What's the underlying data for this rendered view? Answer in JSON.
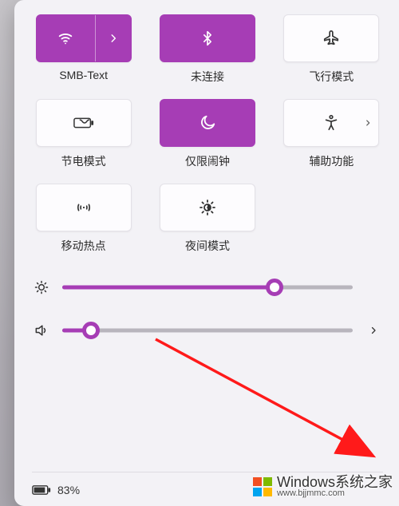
{
  "tiles": [
    {
      "id": "wifi",
      "label": "SMB-Text",
      "icon": "wifi-icon",
      "active": true,
      "split": true
    },
    {
      "id": "bluetooth",
      "label": "未连接",
      "icon": "bluetooth-icon",
      "active": true,
      "split": false
    },
    {
      "id": "airplane",
      "label": "飞行模式",
      "icon": "airplane-icon",
      "active": false,
      "split": false
    },
    {
      "id": "battery-saver",
      "label": "节电模式",
      "icon": "battery-saver-icon",
      "active": false,
      "split": false
    },
    {
      "id": "focus",
      "label": "仅限闹钟",
      "icon": "moon-icon",
      "active": true,
      "split": false
    },
    {
      "id": "accessibility",
      "label": "辅助功能",
      "icon": "accessibility-icon",
      "active": false,
      "split": false,
      "sideArrow": true
    },
    {
      "id": "hotspot",
      "label": "移动热点",
      "icon": "hotspot-icon",
      "active": false,
      "split": false
    },
    {
      "id": "night-light",
      "label": "夜间模式",
      "icon": "night-light-icon",
      "active": false,
      "split": false
    }
  ],
  "sliders": {
    "brightness": {
      "percent": 73,
      "icon": "brightness-icon"
    },
    "volume": {
      "percent": 10,
      "icon": "speaker-icon",
      "hasArrow": true
    }
  },
  "battery": {
    "percent_text": "83%",
    "icon": "battery-icon"
  },
  "watermark": {
    "site_text": "Windows系统之家",
    "url_text": "www.bjjmmc.com",
    "logo_colors": [
      "#f25022",
      "#7fba00",
      "#00a4ef",
      "#ffb900"
    ]
  },
  "colors": {
    "accent": "#a63db5"
  }
}
